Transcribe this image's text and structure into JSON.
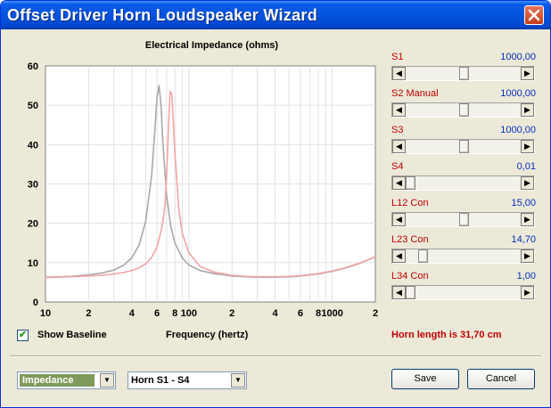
{
  "window": {
    "title": "Offset Driver Horn Loudspeaker Wizard",
    "close_glyph": "✕"
  },
  "chart": {
    "title": "Electrical Impedance (ohms)",
    "xlabel": "Frequency (hertz)"
  },
  "chart_data": {
    "type": "line",
    "title": "Electrical Impedance (ohms)",
    "xlabel": "Frequency (hertz)",
    "ylabel": "",
    "x_scale": "log",
    "xlim": [
      10,
      2000
    ],
    "ylim": [
      0,
      60
    ],
    "x_ticks": [
      10,
      20,
      40,
      60,
      80,
      100,
      200,
      400,
      600,
      800,
      1000,
      2000
    ],
    "x_tick_labels": [
      "10",
      "2",
      "4",
      "6",
      "8",
      "100",
      "2",
      "4",
      "6",
      "8",
      "1000",
      "2"
    ],
    "y_ticks": [
      0,
      10,
      20,
      30,
      40,
      50,
      60
    ],
    "y_tick_labels": [
      "0",
      "10",
      "20",
      "30",
      "40",
      "50",
      "60"
    ],
    "grid": true,
    "series": [
      {
        "color": "#a8a8a8",
        "x": [
          10,
          15,
          20,
          25,
          30,
          35,
          40,
          45,
          50,
          55,
          58,
          60,
          62,
          64,
          66,
          70,
          75,
          80,
          90,
          100,
          120,
          150,
          200,
          250,
          300,
          400,
          500,
          600,
          800,
          1000,
          1200,
          1500,
          2000
        ],
        "y": [
          6.3,
          6.5,
          6.9,
          7.4,
          8.1,
          9.3,
          11.2,
          14.5,
          20.5,
          32,
          44,
          52,
          55,
          50,
          40,
          27,
          19,
          15,
          11.2,
          9.4,
          8,
          7.2,
          6.6,
          6.4,
          6.3,
          6.3,
          6.4,
          6.6,
          7.1,
          7.8,
          8.5,
          9.6,
          11.5
        ]
      },
      {
        "color": "#f4a4a4",
        "x": [
          10,
          15,
          20,
          25,
          30,
          35,
          40,
          45,
          50,
          55,
          60,
          65,
          68,
          70,
          72,
          74,
          76,
          80,
          85,
          90,
          100,
          120,
          150,
          200,
          250,
          300,
          400,
          500,
          600,
          800,
          1000,
          1200,
          1500,
          2000
        ],
        "y": [
          6.2,
          6.4,
          6.6,
          6.8,
          7.1,
          7.5,
          8,
          8.7,
          9.7,
          11.3,
          14,
          19,
          24,
          32,
          44,
          53.5,
          53,
          38,
          24,
          17.5,
          12.5,
          9,
          7.6,
          6.8,
          6.5,
          6.4,
          6.4,
          6.5,
          6.7,
          7.2,
          7.9,
          8.6,
          9.7,
          11.5
        ]
      }
    ]
  },
  "sliders": [
    {
      "label": "S1",
      "value": "1000,00",
      "level": 0.5
    },
    {
      "label": "S2  Manual",
      "value": "1000,00",
      "level": 0.5
    },
    {
      "label": "S3",
      "value": "1000,00",
      "level": 0.5
    },
    {
      "label": "S4",
      "value": "0,01",
      "level": 0.0
    },
    {
      "label": "L12  Con",
      "value": "15,00",
      "level": 0.5
    },
    {
      "label": "L23  Con",
      "value": "14,70",
      "level": 0.12
    },
    {
      "label": "L34  Con",
      "value": "1,00",
      "level": 0.0
    }
  ],
  "arrows": {
    "left": "◀",
    "right": "▶",
    "down": "▼"
  },
  "options": {
    "show_baseline_label": "Show Baseline",
    "show_baseline_checked": true,
    "check_glyph": "✔"
  },
  "horn_length_text": "Horn length is 31,70 cm",
  "footer": {
    "view_select_value": "Impedance",
    "horn_select_value": "Horn S1 - S4",
    "save_label": "Save",
    "cancel_label": "Cancel"
  }
}
